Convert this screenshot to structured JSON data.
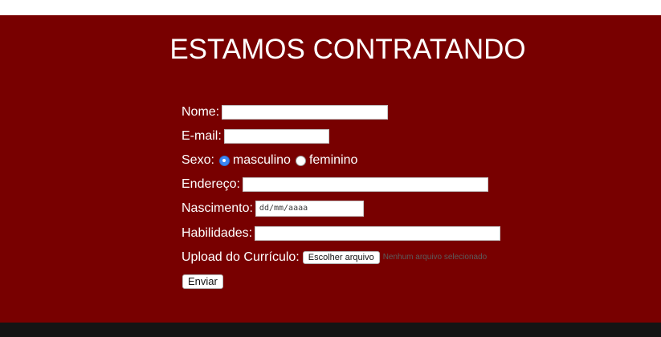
{
  "page": {
    "title": "ESTAMOS CONTRATANDO"
  },
  "form": {
    "nome": {
      "label": "Nome:",
      "value": ""
    },
    "email": {
      "label": "E-mail:",
      "value": ""
    },
    "sexo": {
      "label": "Sexo:",
      "options": [
        {
          "label": "masculino",
          "selected": true
        },
        {
          "label": "feminino",
          "selected": false
        }
      ]
    },
    "endereco": {
      "label": "Endereço:",
      "value": ""
    },
    "nascimento": {
      "label": "Nascimento:",
      "placeholder": "dd/mm/aaaa"
    },
    "habilidades": {
      "label": "Habilidades:",
      "value": ""
    },
    "curriculo": {
      "label": "Upload do Currículo:",
      "button_label": "Escolher arquivo",
      "status": "Nenhum arquivo selecionado"
    },
    "submit_label": "Enviar"
  },
  "colors": {
    "hero_background": "#780000",
    "footer_background": "#141414",
    "radio_selected": "#3b86f2"
  }
}
